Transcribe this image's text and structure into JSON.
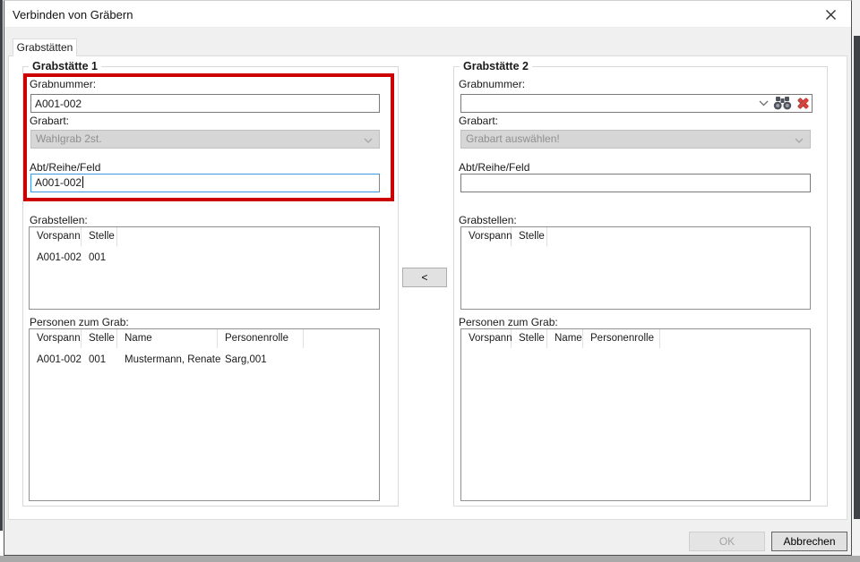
{
  "window": {
    "title": "Verbinden von Gräbern"
  },
  "tab": {
    "label": "Grabstätten"
  },
  "grabstaette1": {
    "title": "Grabstätte 1",
    "grabnummer": {
      "label": "Grabnummer:",
      "value": "A001-002"
    },
    "grabart": {
      "label": "Grabart:",
      "value": "Wahlgrab 2st."
    },
    "abt_reihe_feld": {
      "label": "Abt/Reihe/Feld",
      "value": "A001-002"
    },
    "grabstellen": {
      "label": "Grabstellen:",
      "headers": [
        "Vorspann",
        "Stelle"
      ],
      "rows": [
        [
          "A001-002",
          "001"
        ]
      ]
    },
    "personen": {
      "label": "Personen zum Grab:",
      "headers": [
        "Vorspann",
        "Stelle",
        "Name",
        "Personenrolle"
      ],
      "rows": [
        [
          "A001-002",
          "001",
          "Mustermann, Renate",
          "Sarg,001"
        ]
      ]
    }
  },
  "grabstaette2": {
    "title": "Grabstätte 2",
    "grabnummer": {
      "label": "Grabnummer:",
      "value": ""
    },
    "grabart": {
      "label": "Grabart:",
      "placeholder": "Grabart auswählen!"
    },
    "abt_reihe_feld": {
      "label": "Abt/Reihe/Feld",
      "value": ""
    },
    "grabstellen": {
      "label": "Grabstellen:",
      "headers": [
        "Vorspann",
        "Stelle"
      ],
      "rows": []
    },
    "personen": {
      "label": "Personen zum Grab:",
      "headers": [
        "Vorspann",
        "Stelle",
        "Name",
        "Personenrolle"
      ],
      "rows": []
    }
  },
  "transfer": {
    "label": "<"
  },
  "footer": {
    "ok": "OK",
    "cancel": "Abbrechen"
  },
  "icons": {
    "close": "x-icon",
    "dropdown": "chevron-down-icon",
    "search": "binoculars-icon",
    "clear": "red-x-icon"
  },
  "colors": {
    "highlight_red": "#cc0000",
    "focus_blue": "#3f97e0",
    "clear_x_red": "#d6453f",
    "dialog_bg": "#f0f0f0"
  }
}
